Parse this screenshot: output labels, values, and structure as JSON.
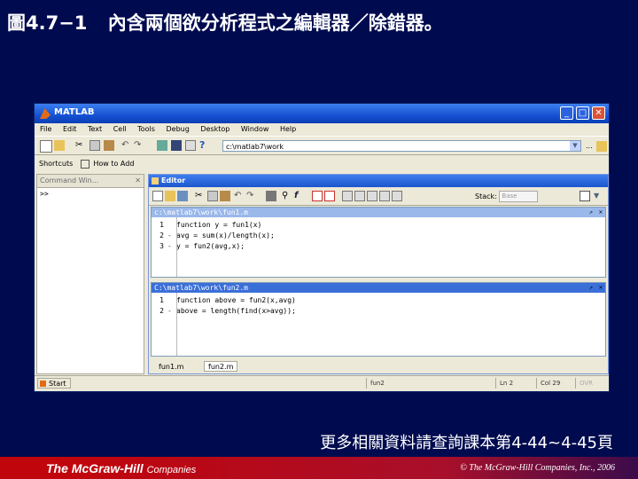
{
  "slide": {
    "figure_number": "圖4.7−1",
    "caption": "內含兩個欲分析程式之編輯器／除錯器。",
    "more_info": "更多相關資料請查詢課本第4-44~4-45頁"
  },
  "matlab": {
    "window_title": "MATLAB",
    "menu": [
      "File",
      "Edit",
      "Text",
      "Cell",
      "Tools",
      "Debug",
      "Desktop",
      "Window",
      "Help"
    ],
    "current_directory": "c:\\matlab7\\work",
    "shortcuts_label": "Shortcuts",
    "how_to_add_label": "How to Add",
    "command_window": {
      "title": "Command Win...",
      "prompt": ">>"
    },
    "editor": {
      "title": "Editor",
      "stack_label": "Stack:",
      "stack_value": "Base",
      "file1": {
        "path": "c:\\matlab7\\work\\fun1.m",
        "lines": [
          {
            "num": "1",
            "marker": "",
            "code": "function y = fun1(x)"
          },
          {
            "num": "2",
            "marker": "-",
            "code": "avg = sum(x)/length(x);"
          },
          {
            "num": "3",
            "marker": "-",
            "code": "y = fun2(avg,x);"
          }
        ]
      },
      "file2": {
        "path": "C:\\matlab7\\work\\fun2.m",
        "lines": [
          {
            "num": "1",
            "marker": "",
            "code": "function above = fun2(x,avg)"
          },
          {
            "num": "2",
            "marker": "-",
            "code": "above = length(find(x>avg));"
          }
        ]
      },
      "tabs": [
        "fun1.m",
        "fun2.m"
      ]
    },
    "status": {
      "start_label": "Start",
      "file": "fun2",
      "ln_label": "Ln",
      "ln_value": "2",
      "col_label": "Col",
      "col_value": "29",
      "ovr_label": "OVR"
    }
  },
  "footer": {
    "brand_the": "The",
    "brand_name": "McGraw-Hill",
    "brand_companies": "Companies",
    "copyright": "© The McGraw-Hill Companies, Inc., 2006"
  }
}
